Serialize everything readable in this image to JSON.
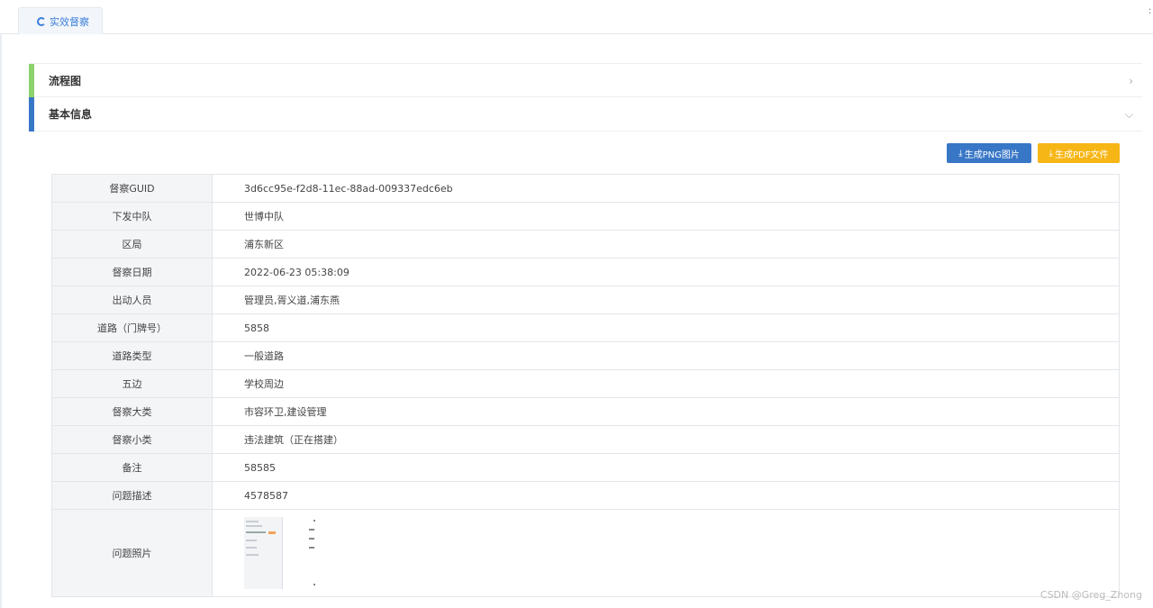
{
  "tab": {
    "label": "实效督察"
  },
  "sections": {
    "flow": "流程图",
    "basic": "基本信息"
  },
  "colors": {
    "flow_bar": "#8bd36a",
    "basic_bar": "#3876c6",
    "png_button": "#3876c6",
    "pdf_button": "#f6b616"
  },
  "buttons": {
    "png": "生成PNG图片",
    "pdf": "生成PDF文件"
  },
  "rows": [
    {
      "label": "督察GUID",
      "value": "3d6cc95e-f2d8-11ec-88ad-009337edc6eb"
    },
    {
      "label": "下发中队",
      "value": "世博中队"
    },
    {
      "label": "区局",
      "value": "浦东新区"
    },
    {
      "label": "督察日期",
      "value": "2022-06-23 05:38:09"
    },
    {
      "label": "出动人员",
      "value": "管理员,胥义道,浦东燕"
    },
    {
      "label": "道路（门牌号）",
      "value": "5858"
    },
    {
      "label": "道路类型",
      "value": "一般道路"
    },
    {
      "label": "五边",
      "value": "学校周边"
    },
    {
      "label": "督察大类",
      "value": "市容环卫,建设管理"
    },
    {
      "label": "督察小类",
      "value": "违法建筑（正在搭建）"
    },
    {
      "label": "备注",
      "value": "58585"
    },
    {
      "label": "问题描述",
      "value": "4578587"
    }
  ],
  "photo_label": "问题照片",
  "watermark": "CSDN @Greg_Zhong"
}
